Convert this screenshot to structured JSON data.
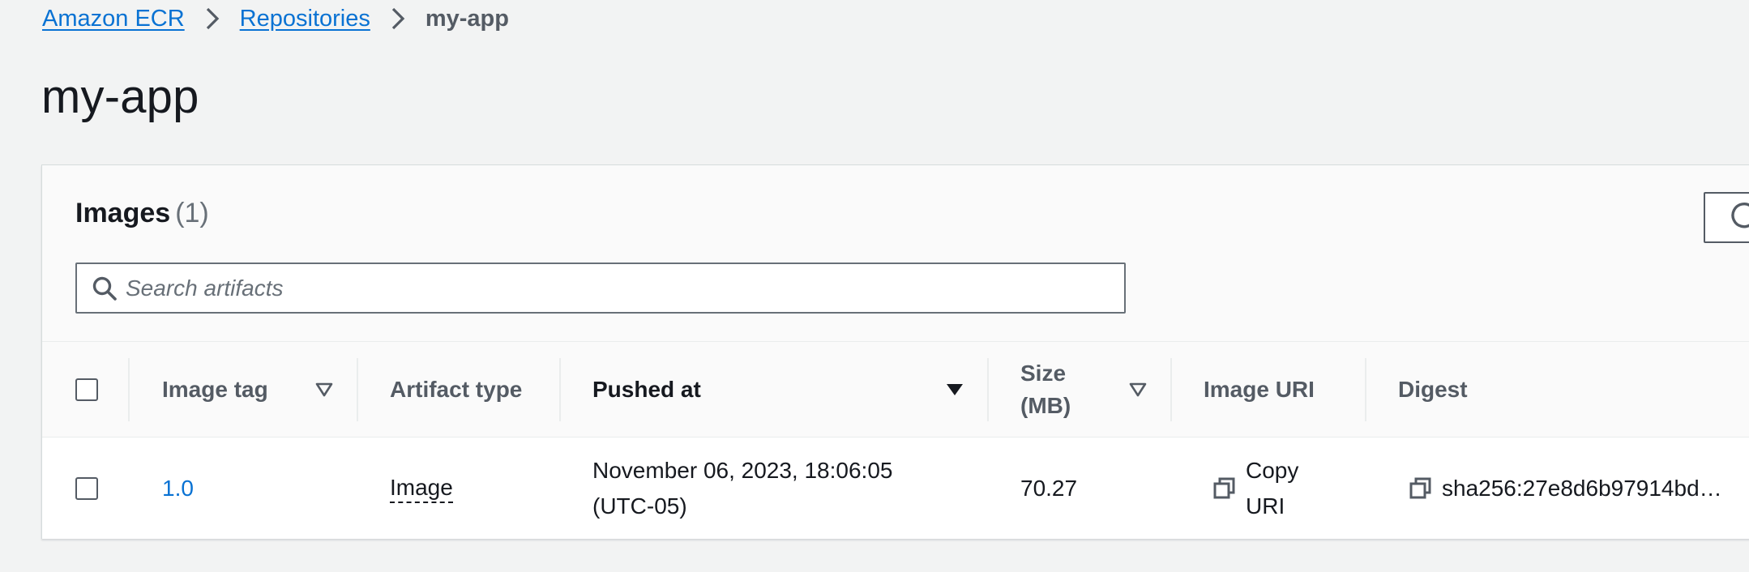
{
  "breadcrumb": {
    "items": [
      "Amazon ECR",
      "Repositories"
    ],
    "current": "my-app"
  },
  "page": {
    "title": "my-app"
  },
  "images_panel": {
    "title": "Images",
    "count": "(1)",
    "search": {
      "placeholder": "Search artifacts",
      "value": ""
    },
    "refresh_icon": "refresh-icon"
  },
  "table": {
    "columns": {
      "image_tag": "Image tag",
      "artifact_type": "Artifact type",
      "pushed_at": "Pushed at",
      "size_line1": "Size",
      "size_line2": "(MB)",
      "image_uri": "Image URI",
      "digest": "Digest"
    },
    "sort": {
      "active_column": "Pushed at",
      "direction": "descending"
    },
    "rows": [
      {
        "image_tag": "1.0",
        "artifact_type": "Image",
        "pushed_at_line1": "November 06, 2023, 18:06:05",
        "pushed_at_line2": "(UTC-05)",
        "size": "70.27",
        "image_uri_line1": "Copy",
        "image_uri_line2": "URI",
        "digest": "sha256:27e8d6b97914bd…"
      }
    ]
  },
  "colors": {
    "link": "#0972d3",
    "background": "#f2f3f3",
    "text": "#16191f",
    "muted": "#545b64"
  }
}
